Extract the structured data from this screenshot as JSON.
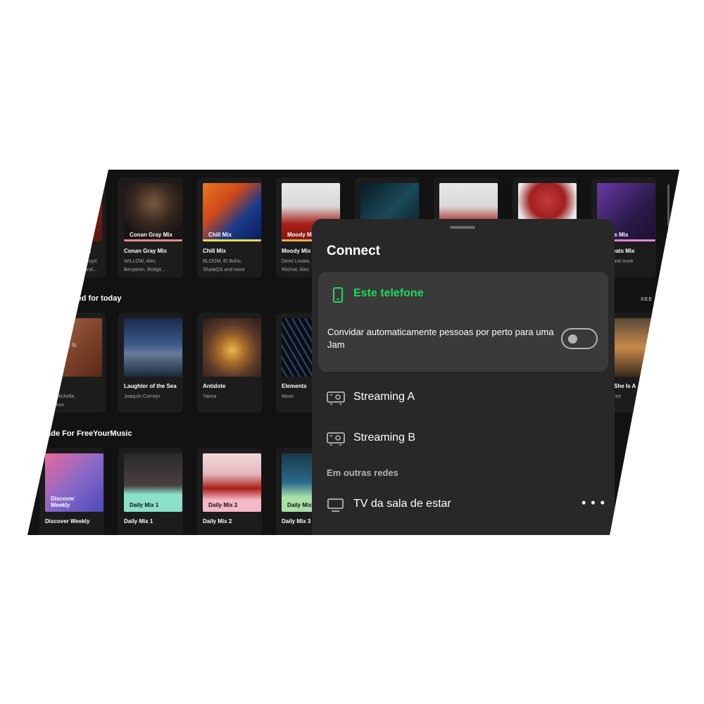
{
  "row1": [
    {
      "art_label": "",
      "title": "Mix",
      "sub1": "r Lloyd,",
      "sub2": "r and..."
    },
    {
      "art_label": "Conan Gray Mix",
      "title": "Conan Gray Mix",
      "sub1": "WILLOW, Alec",
      "sub2": "Benjamin, Bridgit..."
    },
    {
      "art_label": "Chill Mix",
      "title": "Chill Mix",
      "sub1": "BLOOM, El Búho,",
      "sub2": "ShataQS and more"
    },
    {
      "art_label": "Moody Mix",
      "title": "Moody Mix",
      "sub1": "Demi Lovato,",
      "sub2": "Ritchot, Alec"
    },
    {
      "art_label": "",
      "title": "",
      "sub1": "",
      "sub2": ""
    },
    {
      "art_label": "",
      "title": "",
      "sub1": "",
      "sub2": ""
    },
    {
      "art_label": "",
      "title": "",
      "sub1": "",
      "sub2": ""
    },
    {
      "art_label": "beats Mix",
      "title": "eats Mix",
      "sub1": "and more",
      "sub2": ""
    }
  ],
  "section_recommended": "ended for today",
  "see_all": "SEE A",
  "row2": [
    {
      "art_label": "LISTEN",
      "title": "n",
      "sub1": "ire Michelle,",
      "sub2": "rtigeux"
    },
    {
      "art_label": "",
      "title": "Laughter of the Sea",
      "sub1": "Joaquín Cornejo",
      "sub2": ""
    },
    {
      "art_label": "",
      "title": "Antidote",
      "sub1": "Yaima",
      "sub2": ""
    },
    {
      "art_label": "",
      "title": "Elements",
      "sub1": "Mose",
      "sub2": ""
    },
    {
      "art_label": "",
      "title": "She Is A",
      "sub1": "ree",
      "sub2": ""
    }
  ],
  "section_made_for": "Made For FreeYourMusic",
  "row3": [
    {
      "art_label": "Discover Weekly",
      "title": "Discover Weekly"
    },
    {
      "art_label": "Daily Mix 1",
      "title": "Daily Mix 1"
    },
    {
      "art_label": "Daily Mix 2",
      "title": "Daily Mix 2"
    },
    {
      "art_label": "Daily Mix",
      "title": "Daily Mix 3"
    }
  ],
  "connect": {
    "title": "Connect",
    "current_device": "Este telefone",
    "jam_text": "Convidar automaticamente pessoas por perto para uma Jam",
    "jam_toggle_on": false,
    "devices": [
      "Streaming A",
      "Streaming B"
    ],
    "other_networks_label": "Em outras redes",
    "other_devices": [
      "TV da sala de estar"
    ],
    "more_label": "• • •"
  },
  "colors": {
    "accent": "#1ed760",
    "background": "#121212",
    "sheet": "#282828",
    "card": "#1c1c1c"
  },
  "icons": [
    "phone-icon",
    "speaker-icon",
    "tv-icon",
    "more-icon"
  ]
}
